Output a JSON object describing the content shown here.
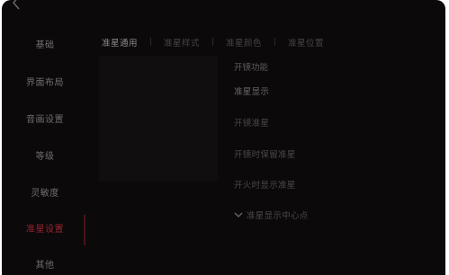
{
  "sidebar": {
    "items": [
      {
        "label": "基础"
      },
      {
        "label": "界面布局"
      },
      {
        "label": "音画设置"
      },
      {
        "label": "等级"
      },
      {
        "label": "灵敏度"
      },
      {
        "label": "准星设置"
      },
      {
        "label": "其他"
      }
    ],
    "active_index": 5
  },
  "tabs": [
    {
      "label": "准星通用"
    },
    {
      "label": "准星样式"
    },
    {
      "label": "准星颜色"
    },
    {
      "label": "准星位置"
    }
  ],
  "options": {
    "title": "开镜功能",
    "items": [
      {
        "label": "准星显示"
      },
      {
        "label": "开镜准星"
      },
      {
        "label": "开镜时保留准星"
      },
      {
        "label": "开火时显示准星"
      },
      {
        "label": "准星显示中心点"
      }
    ]
  },
  "colors": {
    "accent": "#9b2230",
    "background": "#0b090a"
  }
}
